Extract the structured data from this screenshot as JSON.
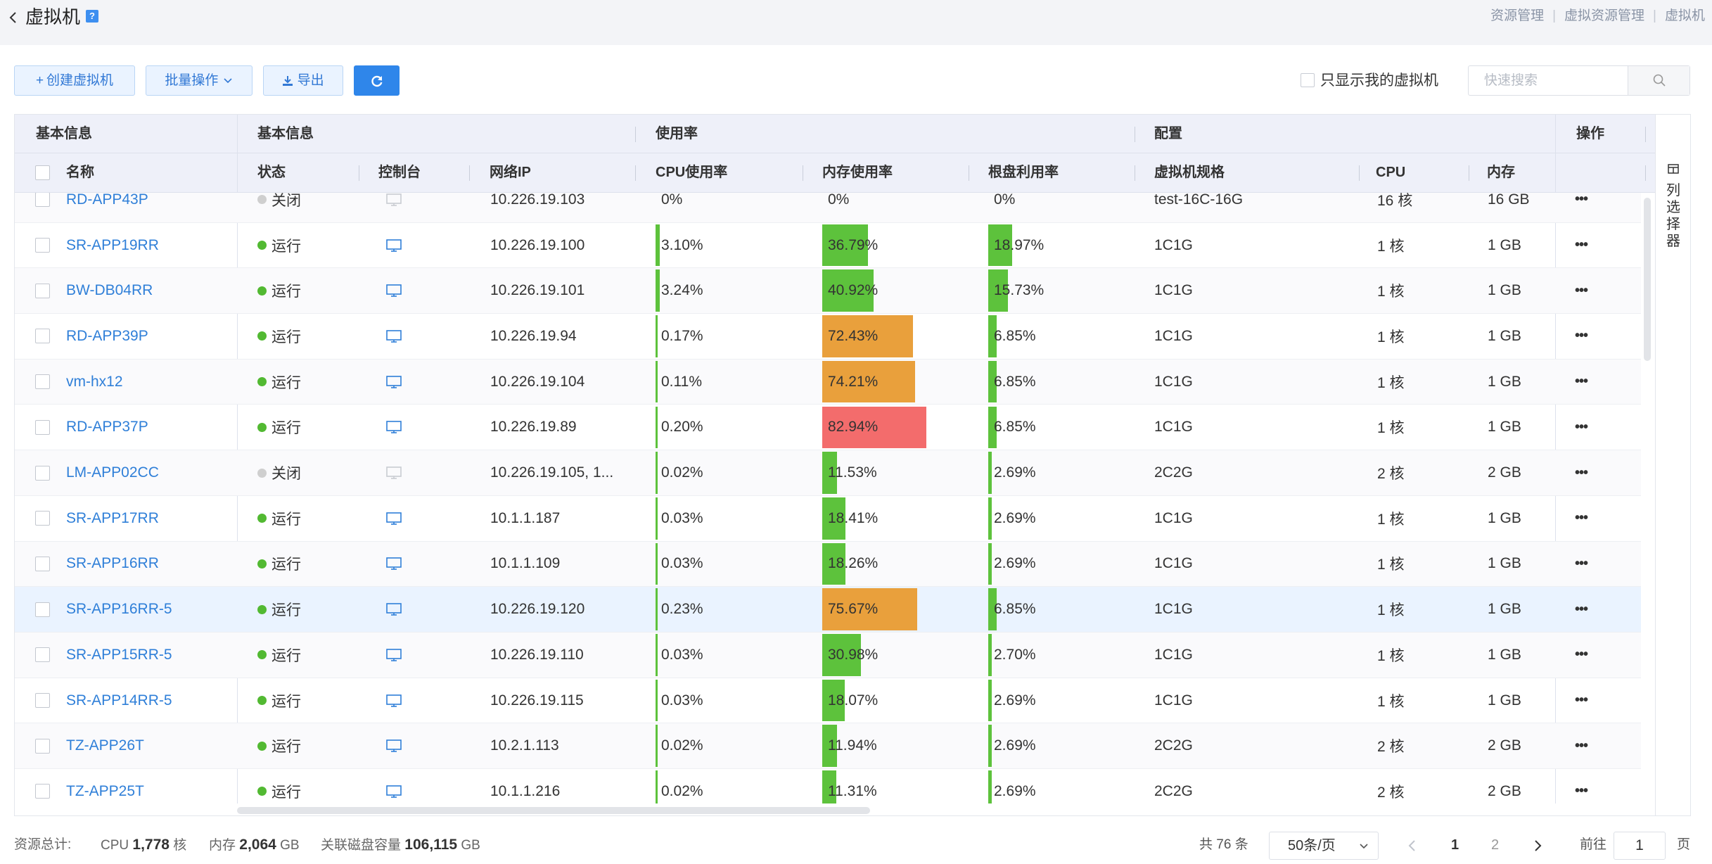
{
  "header": {
    "title": "虚拟机",
    "help": "?",
    "breadcrumb": [
      "资源管理",
      "虚拟资源管理",
      "虚拟机"
    ]
  },
  "toolbar": {
    "create_label": "创建虚拟机",
    "batch_label": "批量操作",
    "export_label": "导出",
    "only_mine_label": "只显示我的虚拟机",
    "search_placeholder": "快速搜索"
  },
  "table": {
    "group_headers": {
      "basic1": "基本信息",
      "basic2": "基本信息",
      "usage": "使用率",
      "config": "配置",
      "actions": "操作"
    },
    "columns": {
      "name": "名称",
      "status": "状态",
      "console": "控制台",
      "ip": "网络IP",
      "cpu_usage": "CPU使用率",
      "mem_usage": "内存使用率",
      "disk_usage": "根盘利用率",
      "spec": "虚拟机规格",
      "cpu": "CPU",
      "memory": "内存"
    },
    "column_selector": "列选择器",
    "colors": {
      "green": "#5dc23c",
      "orange": "#e9a03c",
      "red": "#f36c6c",
      "cpu_bar": "#5dc23c"
    },
    "rows": [
      {
        "name": "RD-APP43P",
        "status": "关闭",
        "running": false,
        "ip": "10.226.19.103",
        "cpu": "0%",
        "cpu_v": 0,
        "mem": "0%",
        "mem_v": 0,
        "disk": "0%",
        "disk_v": 0,
        "spec": "test-16C-16G",
        "cores": "16 核",
        "ram": "16 GB"
      },
      {
        "name": "SR-APP19RR",
        "status": "运行",
        "running": true,
        "ip": "10.226.19.100",
        "cpu": "3.10%",
        "cpu_v": 3.1,
        "mem": "36.79%",
        "mem_v": 36.79,
        "disk": "18.97%",
        "disk_v": 18.97,
        "spec": "1C1G",
        "cores": "1 核",
        "ram": "1 GB"
      },
      {
        "name": "BW-DB04RR",
        "status": "运行",
        "running": true,
        "ip": "10.226.19.101",
        "cpu": "3.24%",
        "cpu_v": 3.24,
        "mem": "40.92%",
        "mem_v": 40.92,
        "disk": "15.73%",
        "disk_v": 15.73,
        "spec": "1C1G",
        "cores": "1 核",
        "ram": "1 GB"
      },
      {
        "name": "RD-APP39P",
        "status": "运行",
        "running": true,
        "ip": "10.226.19.94",
        "cpu": "0.17%",
        "cpu_v": 0.17,
        "mem": "72.43%",
        "mem_v": 72.43,
        "disk": "6.85%",
        "disk_v": 6.85,
        "spec": "1C1G",
        "cores": "1 核",
        "ram": "1 GB"
      },
      {
        "name": "vm-hx12",
        "status": "运行",
        "running": true,
        "ip": "10.226.19.104",
        "cpu": "0.11%",
        "cpu_v": 0.11,
        "mem": "74.21%",
        "mem_v": 74.21,
        "disk": "6.85%",
        "disk_v": 6.85,
        "spec": "1C1G",
        "cores": "1 核",
        "ram": "1 GB"
      },
      {
        "name": "RD-APP37P",
        "status": "运行",
        "running": true,
        "ip": "10.226.19.89",
        "cpu": "0.20%",
        "cpu_v": 0.2,
        "mem": "82.94%",
        "mem_v": 82.94,
        "disk": "6.85%",
        "disk_v": 6.85,
        "spec": "1C1G",
        "cores": "1 核",
        "ram": "1 GB"
      },
      {
        "name": "LM-APP02CC",
        "status": "关闭",
        "running": false,
        "ip": "10.226.19.105, 1...",
        "cpu": "0.02%",
        "cpu_v": 0.02,
        "mem": "11.53%",
        "mem_v": 11.53,
        "disk": "2.69%",
        "disk_v": 2.69,
        "spec": "2C2G",
        "cores": "2 核",
        "ram": "2 GB"
      },
      {
        "name": "SR-APP17RR",
        "status": "运行",
        "running": true,
        "ip": "10.1.1.187",
        "cpu": "0.03%",
        "cpu_v": 0.03,
        "mem": "18.41%",
        "mem_v": 18.41,
        "disk": "2.69%",
        "disk_v": 2.69,
        "spec": "1C1G",
        "cores": "1 核",
        "ram": "1 GB"
      },
      {
        "name": "SR-APP16RR",
        "status": "运行",
        "running": true,
        "ip": "10.1.1.109",
        "cpu": "0.03%",
        "cpu_v": 0.03,
        "mem": "18.26%",
        "mem_v": 18.26,
        "disk": "2.69%",
        "disk_v": 2.69,
        "spec": "1C1G",
        "cores": "1 核",
        "ram": "1 GB"
      },
      {
        "name": "SR-APP16RR-5",
        "status": "运行",
        "running": true,
        "ip": "10.226.19.120",
        "cpu": "0.23%",
        "cpu_v": 0.23,
        "mem": "75.67%",
        "mem_v": 75.67,
        "disk": "6.85%",
        "disk_v": 6.85,
        "spec": "1C1G",
        "cores": "1 核",
        "ram": "1 GB",
        "highlighted": true
      },
      {
        "name": "SR-APP15RR-5",
        "status": "运行",
        "running": true,
        "ip": "10.226.19.110",
        "cpu": "0.03%",
        "cpu_v": 0.03,
        "mem": "30.98%",
        "mem_v": 30.98,
        "disk": "2.70%",
        "disk_v": 2.7,
        "spec": "1C1G",
        "cores": "1 核",
        "ram": "1 GB"
      },
      {
        "name": "SR-APP14RR-5",
        "status": "运行",
        "running": true,
        "ip": "10.226.19.115",
        "cpu": "0.03%",
        "cpu_v": 0.03,
        "mem": "18.07%",
        "mem_v": 18.07,
        "disk": "2.69%",
        "disk_v": 2.69,
        "spec": "1C1G",
        "cores": "1 核",
        "ram": "1 GB"
      },
      {
        "name": "TZ-APP26T",
        "status": "运行",
        "running": true,
        "ip": "10.2.1.113",
        "cpu": "0.02%",
        "cpu_v": 0.02,
        "mem": "11.94%",
        "mem_v": 11.94,
        "disk": "2.69%",
        "disk_v": 2.69,
        "spec": "2C2G",
        "cores": "2 核",
        "ram": "2 GB"
      },
      {
        "name": "TZ-APP25T",
        "status": "运行",
        "running": true,
        "ip": "10.1.1.216",
        "cpu": "0.02%",
        "cpu_v": 0.02,
        "mem": "11.31%",
        "mem_v": 11.31,
        "disk": "2.69%",
        "disk_v": 2.69,
        "spec": "2C2G",
        "cores": "2 核",
        "ram": "2 GB"
      }
    ]
  },
  "footer": {
    "total_label": "资源总计:",
    "cpu_label": "CPU",
    "cpu_value": "1,778",
    "cpu_unit": "核",
    "mem_label": "内存",
    "mem_value": "2,064",
    "mem_unit": "GB",
    "disk_label": "关联磁盘容量",
    "disk_value": "106,115",
    "disk_unit": "GB",
    "total_count": "共 76 条",
    "page_size": "50条/页",
    "pages": [
      "1",
      "2"
    ],
    "current_page": "1",
    "goto_label": "前往",
    "goto_value": "1",
    "page_suffix": "页"
  }
}
